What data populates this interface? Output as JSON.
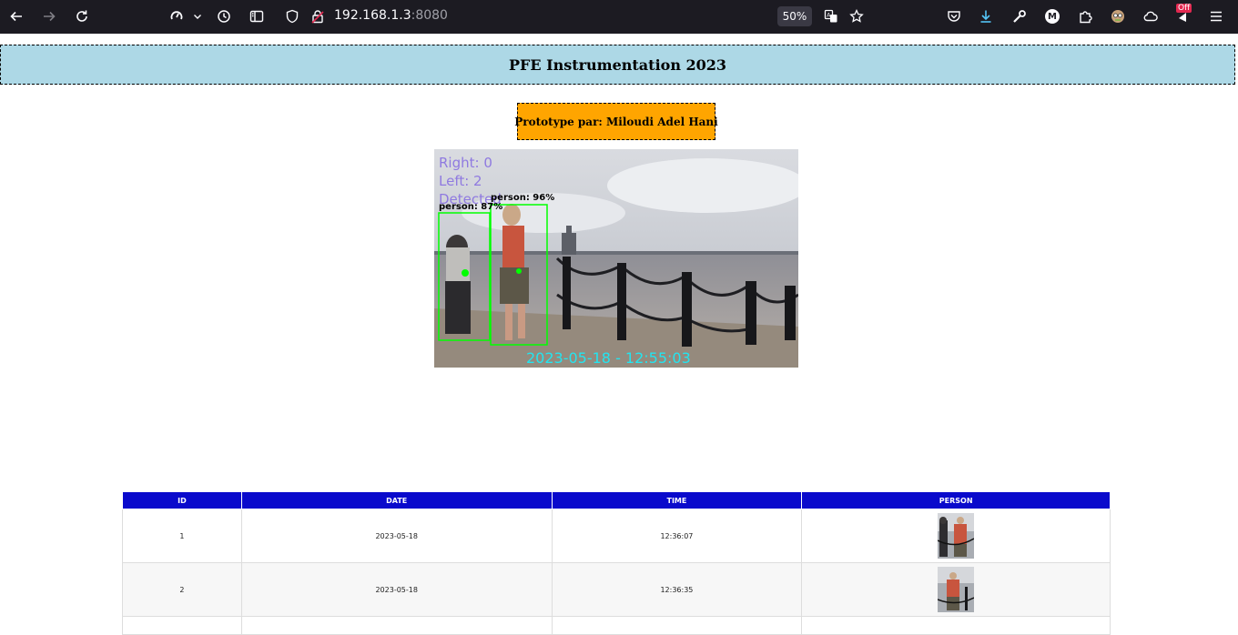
{
  "browser": {
    "url_host": "192.168.1.3",
    "url_port": ":8080",
    "zoom": "50%",
    "off_badge": "Off",
    "account_initial": "M",
    "icons": [
      "back-arrow-icon",
      "forward-arrow-icon",
      "reload-icon",
      "customize-icon",
      "chevron-down-icon",
      "history-icon",
      "sidebar-icon",
      "shield-icon",
      "lock-icon",
      "translate-icon",
      "star-icon",
      "pocket-icon",
      "download-icon",
      "wrench-icon",
      "account-icon",
      "extensions-icon",
      "avatar-icon",
      "cloud-icon",
      "notification-icon",
      "menu-icon"
    ]
  },
  "page": {
    "title": "PFE Instrumentation 2023",
    "prototype": "Prototype par: Miloudi Adel Hani",
    "stream": {
      "right": "Right: 0",
      "left": "Left: 2",
      "detected": "Detected",
      "label_a": "person: 87%",
      "label_b": "person: 96%",
      "timestamp": "2023-05-18 - 12:55:03"
    }
  },
  "colors": {
    "header_bg": "#add8e6",
    "prototype_bg": "#ffa500",
    "table_header_bg": "#0a0acc",
    "box_green": "#00ff00"
  },
  "table": {
    "headers": [
      "ID",
      "DATE",
      "TIME",
      "PERSON"
    ],
    "rows": [
      {
        "id": "1",
        "date": "2023-05-18",
        "time": "12:36:07"
      },
      {
        "id": "2",
        "date": "2023-05-18",
        "time": "12:36:35"
      }
    ]
  }
}
